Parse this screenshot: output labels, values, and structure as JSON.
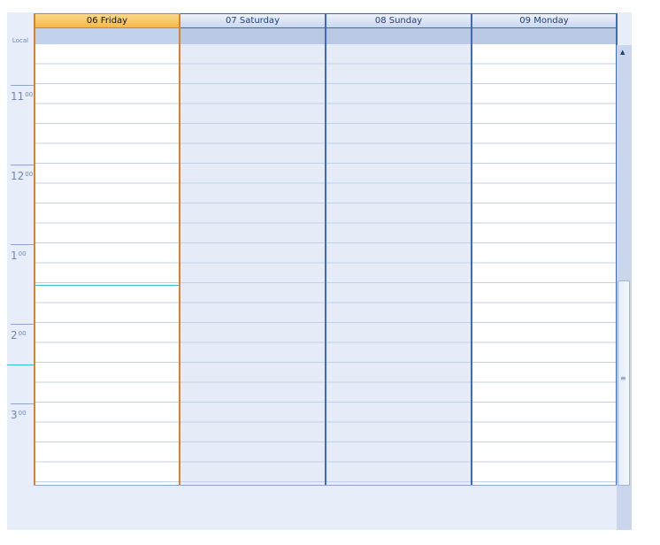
{
  "timeRuler": {
    "zoneLabel": "Local",
    "hours": [
      {
        "hour": "11",
        "minutes": "00"
      },
      {
        "hour": "12",
        "minutes": "00"
      },
      {
        "hour": "1",
        "minutes": "00"
      },
      {
        "hour": "2",
        "minutes": "00"
      },
      {
        "hour": "3",
        "minutes": "00"
      }
    ]
  },
  "days": [
    {
      "label": "06 Friday",
      "today": true,
      "background": "white"
    },
    {
      "label": "07 Saturday",
      "today": false,
      "background": "blue"
    },
    {
      "label": "08 Sunday",
      "today": false,
      "background": "blue"
    },
    {
      "label": "09 Monday",
      "today": false,
      "background": "white"
    }
  ],
  "colors": {
    "todayBorder": "#d9822b",
    "dayBorder": "#3f6bb6",
    "currentTimeLine": "#2fc0d7"
  },
  "scrollbar": {
    "grip_icon": "grip-lines-icon",
    "up_icon": "scroll-up-arrow-icon"
  }
}
